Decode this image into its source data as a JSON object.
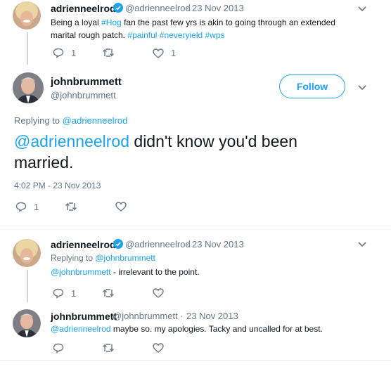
{
  "tweet1": {
    "name": "adrienneelrod",
    "handle": "@adrienneelrod",
    "dot": "·",
    "date": "23 Nov 2013",
    "text_a": "Being a loyal ",
    "hashtag_hog": "#Hog",
    "text_b": " fan the past few yrs is akin to going through an extended",
    "text_c": "marital rough patch. ",
    "hashtag_painful": "#painful",
    "hashtag_neveryield": "#neveryield",
    "hashtag_wps": "#wps",
    "reply_count": "1",
    "like_count": "1"
  },
  "main": {
    "name": "johnbrummett",
    "handle": "@johnbrummett",
    "follow_label": "Follow",
    "replying_prefix": "Replying to ",
    "replying_handle": "@adrienneelrod",
    "mention": "@adrienneelrod",
    "text_line1": " didn't know you'd been",
    "text_line2": "married.",
    "timestamp": "4:02 PM - 23 Nov 2013",
    "reply_count": "1"
  },
  "reply1": {
    "name": "adrienneelrod",
    "handle": "@adrienneelrod",
    "dot": "·",
    "date": "23 Nov 2013",
    "replying_prefix": "Replying to ",
    "replying_handle": "@johnbrummett",
    "mention": "@johnbrummett",
    "text": " - irrelevant to the point.",
    "reply_count": "1"
  },
  "reply2": {
    "name": "johnbrummett",
    "handle": "@johnbrummett",
    "dot": "·",
    "date": "23 Nov 2013",
    "mention": "@adrienneelrod",
    "text": " maybe so. my apologies. Tacky and uncalled for at best."
  },
  "colors": {
    "accent": "#1da1f2",
    "muted": "#657786",
    "verified": "#1da1f2"
  }
}
